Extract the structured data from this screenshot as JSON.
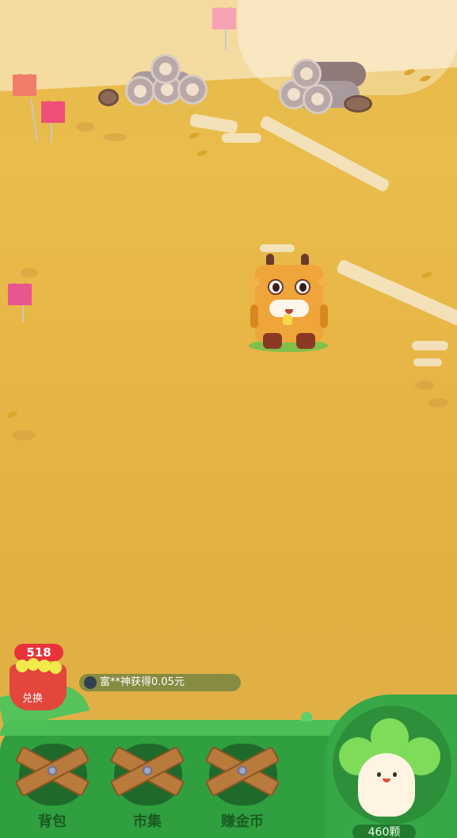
{
  "game": {
    "coins": "518",
    "basket_label": "兑换",
    "notice_text": "富**神获得0.05元",
    "nav": [
      {
        "label": "背包"
      },
      {
        "label": "市集"
      },
      {
        "label": "赚金币"
      }
    ],
    "sprout_count": "460颗"
  },
  "colors": {
    "ground": "#e7b53f",
    "bar_green": "#2f9f3f",
    "coin_red": "#e8333b",
    "cow_orange": "#f0a53a"
  },
  "icons": [
    "cow-character",
    "heart-balloon",
    "log-pile",
    "basket-icon",
    "wooden-plank-lock",
    "sprout-character"
  ]
}
